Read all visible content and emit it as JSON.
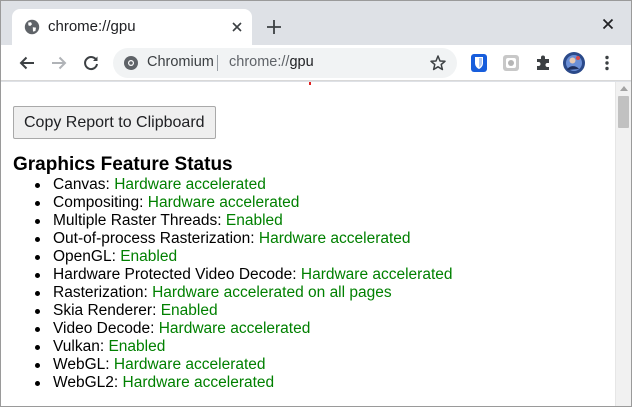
{
  "tab": {
    "title": "chrome://gpu"
  },
  "omnibox": {
    "origin": "Chromium",
    "url_scheme": "chrome://",
    "url_host": "gpu"
  },
  "page": {
    "copy_button_label": "Copy Report to Clipboard",
    "section_title": "Graphics Feature Status",
    "features": [
      {
        "name": "Canvas:",
        "status": "Hardware accelerated"
      },
      {
        "name": "Compositing:",
        "status": "Hardware accelerated"
      },
      {
        "name": "Multiple Raster Threads:",
        "status": "Enabled"
      },
      {
        "name": "Out-of-process Rasterization:",
        "status": "Hardware accelerated"
      },
      {
        "name": "OpenGL:",
        "status": "Enabled"
      },
      {
        "name": "Hardware Protected Video Decode:",
        "status": "Hardware accelerated"
      },
      {
        "name": "Rasterization:",
        "status": "Hardware accelerated on all pages"
      },
      {
        "name": "Skia Renderer:",
        "status": "Enabled"
      },
      {
        "name": "Video Decode:",
        "status": "Hardware accelerated"
      },
      {
        "name": "Vulkan:",
        "status": "Enabled"
      },
      {
        "name": "WebGL:",
        "status": "Hardware accelerated"
      },
      {
        "name": "WebGL2:",
        "status": "Hardware accelerated"
      }
    ]
  },
  "colors": {
    "enabled_status": "#008000",
    "tabstrip": "#dee1e6",
    "omnibox": "#f1f3f4",
    "bitwarden": "#175ddc"
  },
  "icons": {
    "favicon": "globe-icon",
    "tab_close": "close-icon",
    "new_tab": "plus-icon",
    "window_close": "close-icon",
    "back": "arrow-left-icon",
    "forward": "arrow-right-icon",
    "reload": "reload-icon",
    "bookmark": "star-icon",
    "extensions": [
      "bitwarden-icon",
      "extension-placeholder-icon",
      "puzzle-icon"
    ],
    "profile": "avatar",
    "menu": "kebab-menu-icon"
  }
}
